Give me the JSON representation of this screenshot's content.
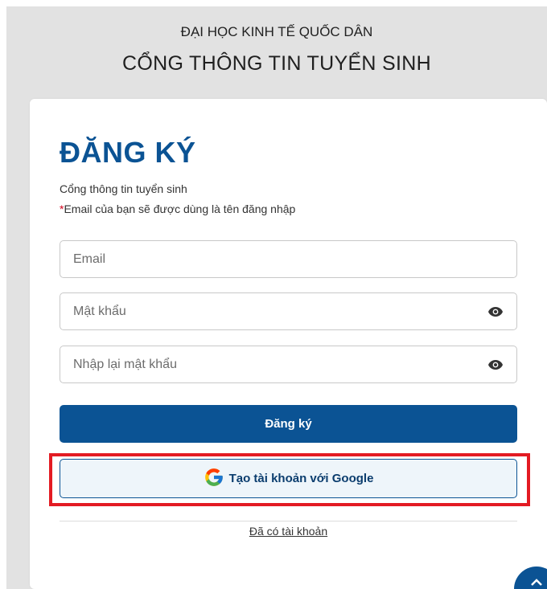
{
  "header": {
    "university": "ĐẠI HỌC KINH TẾ QUỐC DÂN",
    "portal_title": "CỔNG THÔNG TIN TUYỂN SINH"
  },
  "form": {
    "title": "ĐĂNG KÝ",
    "subtitle": "Cổng thông tin tuyển sinh",
    "note_star": "*",
    "note_text": "Email của bạn sẽ được dùng là tên đăng nhập",
    "email_placeholder": "Email",
    "password_placeholder": "Mật khẩu",
    "confirm_placeholder": "Nhập lại mật khẩu",
    "register_label": "Đăng ký",
    "google_label": "Tạo tài khoản với Google",
    "login_link": "Đã có tài khoản"
  },
  "icons": {
    "password_toggle": "eye-icon",
    "google": "google-g-icon",
    "scroll_top": "chevron-up-icon"
  },
  "colors": {
    "primary": "#0b5394",
    "highlight": "#e31b23",
    "required": "#d0021b"
  }
}
